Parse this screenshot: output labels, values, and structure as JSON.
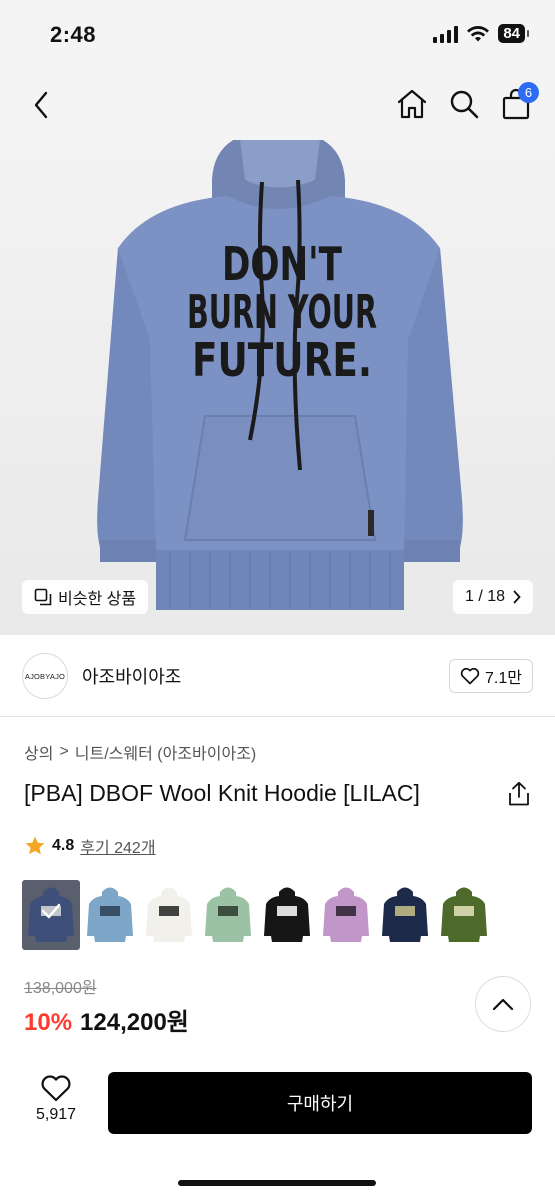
{
  "status_bar": {
    "time": "2:48",
    "battery": "84"
  },
  "nav": {
    "cart_count": "6"
  },
  "hero": {
    "similar_label": "비슷한 상품",
    "page_indicator": "1 / 18",
    "print_lines": [
      "DON'T",
      "BURN YOUR",
      "FUTURE."
    ]
  },
  "brand": {
    "logo_text": "AJOBYAJO",
    "name": "아조바이아조",
    "likes": "7.1만"
  },
  "breadcrumb": {
    "category": "상의",
    "separator": ">",
    "subcategory": "니트/스웨터 (아조바이아조)"
  },
  "product": {
    "title": "[PBA] DBOF Wool Knit Hoodie [LILAC]"
  },
  "rating": {
    "score": "4.8",
    "reviews": "후기 242개"
  },
  "swatches": [
    {
      "color": "#3e4f7a",
      "print": "#d8d8d8",
      "selected": true,
      "name": "swatch-navy-blue"
    },
    {
      "color": "#7ea6c9",
      "print": "#2c3f55",
      "selected": false,
      "name": "swatch-sky-blue"
    },
    {
      "color": "#f2f0ea",
      "print": "#222222",
      "selected": false,
      "name": "swatch-white"
    },
    {
      "color": "#9cc2a6",
      "print": "#2a3a2e",
      "selected": false,
      "name": "swatch-mint"
    },
    {
      "color": "#161616",
      "print": "#ffffff",
      "selected": false,
      "name": "swatch-black"
    },
    {
      "color": "#c197c9",
      "print": "#2b2030",
      "selected": false,
      "name": "swatch-lavender"
    },
    {
      "color": "#1e2a4a",
      "print": "#c9c48a",
      "selected": false,
      "name": "swatch-dark-navy"
    },
    {
      "color": "#4e6a2a",
      "print": "#e8e2c0",
      "selected": false,
      "name": "swatch-olive"
    }
  ],
  "price": {
    "original": "138,000원",
    "discount": "10%",
    "sale": "124,200원"
  },
  "bottom": {
    "wish_count": "5,917",
    "buy_label": "구매하기"
  },
  "colors": {
    "accent_badge": "#2f6cf6",
    "discount": "#ff3b30",
    "hoodie": "#7c92c4"
  }
}
